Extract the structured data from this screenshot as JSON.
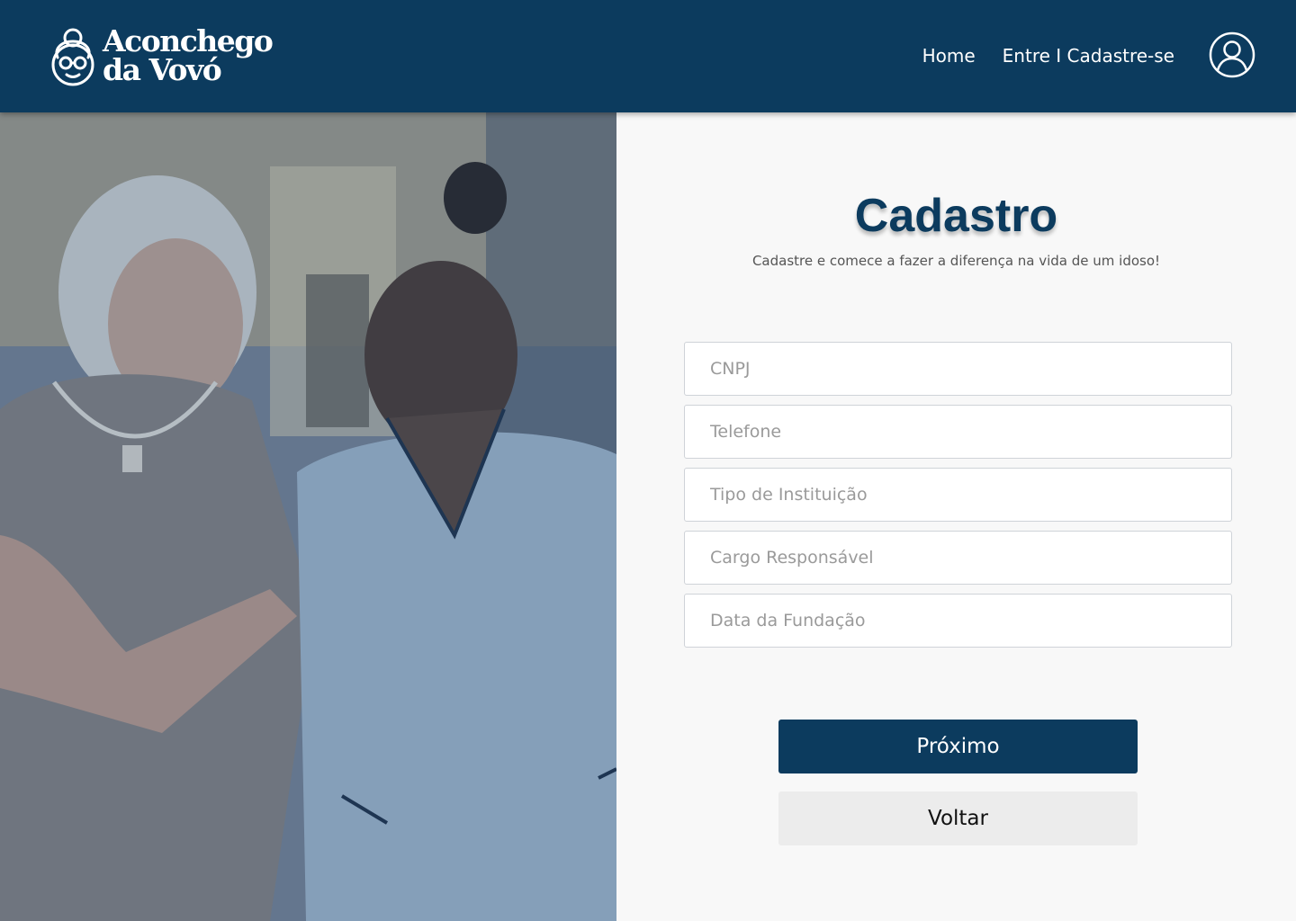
{
  "header": {
    "logo_line1": "Aconchego",
    "logo_line2": "da Vovó",
    "nav": {
      "home": "Home",
      "login": "Entre I Cadastre-se"
    }
  },
  "form": {
    "title": "Cadastro",
    "subtitle": "Cadastre e comece a fazer a diferença na vida de um idoso!",
    "fields": [
      {
        "placeholder": "CNPJ",
        "value": ""
      },
      {
        "placeholder": "Telefone",
        "value": ""
      },
      {
        "placeholder": "Tipo de Instituição",
        "value": ""
      },
      {
        "placeholder": "Cargo Responsável",
        "value": ""
      },
      {
        "placeholder": "Data da Fundação",
        "value": ""
      }
    ],
    "next_label": "Próximo",
    "back_label": "Voltar"
  },
  "colors": {
    "brand": "#0c3b5e",
    "background": "#f8f8f8",
    "secondary_button": "#ececec"
  },
  "icons": [
    "grandma-logo-icon",
    "user-profile-icon"
  ]
}
